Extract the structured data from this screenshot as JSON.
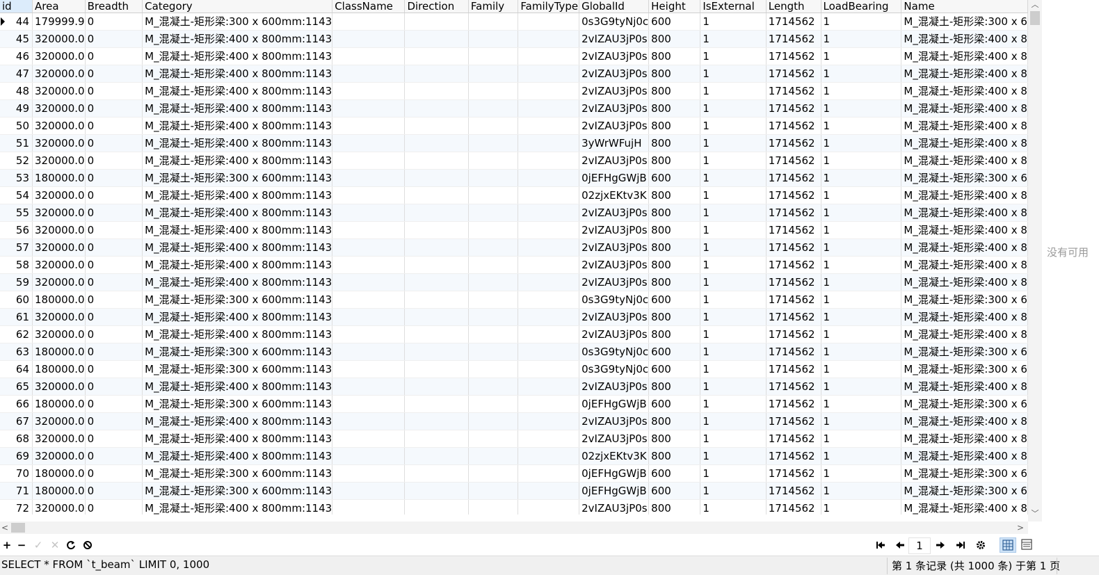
{
  "columns": [
    "id",
    "Area",
    "Breadth",
    "Category",
    "ClassName",
    "Direction",
    "Family",
    "FamilyType",
    "GlobalId",
    "Height",
    "IsExternal",
    "Length",
    "LoadBearing",
    "Name"
  ],
  "rows": [
    [
      "44",
      "179999.9",
      "0",
      "M_混凝土-矩形梁:300 x 600mm:1143",
      "",
      "",
      "",
      "",
      "0s3G9tyNj0c",
      "600",
      "1",
      "1714562",
      "1",
      "M_混凝土-矩形梁:300 x 6"
    ],
    [
      "45",
      "320000.0",
      "0",
      "M_混凝土-矩形梁:400 x 800mm:1143",
      "",
      "",
      "",
      "",
      "2vIZAU3jP0s",
      "800",
      "1",
      "1714562",
      "1",
      "M_混凝土-矩形梁:400 x 8"
    ],
    [
      "46",
      "320000.0",
      "0",
      "M_混凝土-矩形梁:400 x 800mm:1143",
      "",
      "",
      "",
      "",
      "2vIZAU3jP0s",
      "800",
      "1",
      "1714562",
      "1",
      "M_混凝土-矩形梁:400 x 8"
    ],
    [
      "47",
      "320000.0",
      "0",
      "M_混凝土-矩形梁:400 x 800mm:1143",
      "",
      "",
      "",
      "",
      "2vIZAU3jP0s",
      "800",
      "1",
      "1714562",
      "1",
      "M_混凝土-矩形梁:400 x 8"
    ],
    [
      "48",
      "320000.0",
      "0",
      "M_混凝土-矩形梁:400 x 800mm:1143",
      "",
      "",
      "",
      "",
      "2vIZAU3jP0s",
      "800",
      "1",
      "1714562",
      "1",
      "M_混凝土-矩形梁:400 x 8"
    ],
    [
      "49",
      "320000.0",
      "0",
      "M_混凝土-矩形梁:400 x 800mm:1143",
      "",
      "",
      "",
      "",
      "2vIZAU3jP0s",
      "800",
      "1",
      "1714562",
      "1",
      "M_混凝土-矩形梁:400 x 8"
    ],
    [
      "50",
      "320000.0",
      "0",
      "M_混凝土-矩形梁:400 x 800mm:1143",
      "",
      "",
      "",
      "",
      "2vIZAU3jP0s",
      "800",
      "1",
      "1714562",
      "1",
      "M_混凝土-矩形梁:400 x 8"
    ],
    [
      "51",
      "320000.0",
      "0",
      "M_混凝土-矩形梁:400 x 800mm:1143",
      "",
      "",
      "",
      "",
      "3yWrWFujH",
      "800",
      "1",
      "1714562",
      "1",
      "M_混凝土-矩形梁:400 x 8"
    ],
    [
      "52",
      "320000.0",
      "0",
      "M_混凝土-矩形梁:400 x 800mm:1143",
      "",
      "",
      "",
      "",
      "2vIZAU3jP0s",
      "800",
      "1",
      "1714562",
      "1",
      "M_混凝土-矩形梁:400 x 8"
    ],
    [
      "53",
      "180000.0",
      "0",
      "M_混凝土-矩形梁:300 x 600mm:1143",
      "",
      "",
      "",
      "",
      "0jEFHgGWjB",
      "600",
      "1",
      "1714562",
      "1",
      "M_混凝土-矩形梁:300 x 6"
    ],
    [
      "54",
      "320000.0",
      "0",
      "M_混凝土-矩形梁:400 x 800mm:1143",
      "",
      "",
      "",
      "",
      "02zjxEKtv3K",
      "800",
      "1",
      "1714562",
      "1",
      "M_混凝土-矩形梁:400 x 8"
    ],
    [
      "55",
      "320000.0",
      "0",
      "M_混凝土-矩形梁:400 x 800mm:1143",
      "",
      "",
      "",
      "",
      "2vIZAU3jP0s",
      "800",
      "1",
      "1714562",
      "1",
      "M_混凝土-矩形梁:400 x 8"
    ],
    [
      "56",
      "320000.0",
      "0",
      "M_混凝土-矩形梁:400 x 800mm:1143",
      "",
      "",
      "",
      "",
      "2vIZAU3jP0s",
      "800",
      "1",
      "1714562",
      "1",
      "M_混凝土-矩形梁:400 x 8"
    ],
    [
      "57",
      "320000.0",
      "0",
      "M_混凝土-矩形梁:400 x 800mm:1143",
      "",
      "",
      "",
      "",
      "2vIZAU3jP0s",
      "800",
      "1",
      "1714562",
      "1",
      "M_混凝土-矩形梁:400 x 8"
    ],
    [
      "58",
      "320000.0",
      "0",
      "M_混凝土-矩形梁:400 x 800mm:1143",
      "",
      "",
      "",
      "",
      "2vIZAU3jP0s",
      "800",
      "1",
      "1714562",
      "1",
      "M_混凝土-矩形梁:400 x 8"
    ],
    [
      "59",
      "320000.0",
      "0",
      "M_混凝土-矩形梁:400 x 800mm:1143",
      "",
      "",
      "",
      "",
      "2vIZAU3jP0s",
      "800",
      "1",
      "1714562",
      "1",
      "M_混凝土-矩形梁:400 x 8"
    ],
    [
      "60",
      "180000.0",
      "0",
      "M_混凝土-矩形梁:300 x 600mm:1143",
      "",
      "",
      "",
      "",
      "0s3G9tyNj0c",
      "600",
      "1",
      "1714562",
      "1",
      "M_混凝土-矩形梁:300 x 6"
    ],
    [
      "61",
      "320000.0",
      "0",
      "M_混凝土-矩形梁:400 x 800mm:1143",
      "",
      "",
      "",
      "",
      "2vIZAU3jP0s",
      "800",
      "1",
      "1714562",
      "1",
      "M_混凝土-矩形梁:400 x 8"
    ],
    [
      "62",
      "320000.0",
      "0",
      "M_混凝土-矩形梁:400 x 800mm:1143",
      "",
      "",
      "",
      "",
      "2vIZAU3jP0s",
      "800",
      "1",
      "1714562",
      "1",
      "M_混凝土-矩形梁:400 x 8"
    ],
    [
      "63",
      "180000.0",
      "0",
      "M_混凝土-矩形梁:300 x 600mm:1143",
      "",
      "",
      "",
      "",
      "0s3G9tyNj0c",
      "600",
      "1",
      "1714562",
      "1",
      "M_混凝土-矩形梁:300 x 6"
    ],
    [
      "64",
      "180000.0",
      "0",
      "M_混凝土-矩形梁:300 x 600mm:1143",
      "",
      "",
      "",
      "",
      "0s3G9tyNj0c",
      "600",
      "1",
      "1714562",
      "1",
      "M_混凝土-矩形梁:300 x 6"
    ],
    [
      "65",
      "320000.0",
      "0",
      "M_混凝土-矩形梁:400 x 800mm:1143",
      "",
      "",
      "",
      "",
      "2vIZAU3jP0s",
      "800",
      "1",
      "1714562",
      "1",
      "M_混凝土-矩形梁:400 x 8"
    ],
    [
      "66",
      "180000.0",
      "0",
      "M_混凝土-矩形梁:300 x 600mm:1143",
      "",
      "",
      "",
      "",
      "0jEFHgGWjB",
      "600",
      "1",
      "1714562",
      "1",
      "M_混凝土-矩形梁:300 x 6"
    ],
    [
      "67",
      "320000.0",
      "0",
      "M_混凝土-矩形梁:400 x 800mm:1143",
      "",
      "",
      "",
      "",
      "2vIZAU3jP0s",
      "800",
      "1",
      "1714562",
      "1",
      "M_混凝土-矩形梁:400 x 8"
    ],
    [
      "68",
      "320000.0",
      "0",
      "M_混凝土-矩形梁:400 x 800mm:1143",
      "",
      "",
      "",
      "",
      "2vIZAU3jP0s",
      "800",
      "1",
      "1714562",
      "1",
      "M_混凝土-矩形梁:400 x 8"
    ],
    [
      "69",
      "320000.0",
      "0",
      "M_混凝土-矩形梁:400 x 800mm:1143",
      "",
      "",
      "",
      "",
      "02zjxEKtv3K",
      "800",
      "1",
      "1714562",
      "1",
      "M_混凝土-矩形梁:400 x 8"
    ],
    [
      "70",
      "180000.0",
      "0",
      "M_混凝土-矩形梁:300 x 600mm:1143",
      "",
      "",
      "",
      "",
      "0jEFHgGWjB",
      "600",
      "1",
      "1714562",
      "1",
      "M_混凝土-矩形梁:300 x 6"
    ],
    [
      "71",
      "180000.0",
      "0",
      "M_混凝土-矩形梁:300 x 600mm:1143",
      "",
      "",
      "",
      "",
      "0jEFHgGWjB",
      "600",
      "1",
      "1714562",
      "1",
      "M_混凝土-矩形梁:300 x 6"
    ],
    [
      "72",
      "320000.0",
      "0",
      "M_混凝土-矩形梁:400 x 800mm:1143",
      "",
      "",
      "",
      "",
      "2vIZAU3jP0s",
      "800",
      "1",
      "1714562",
      "1",
      "M_混凝土-矩形梁:400 x 8"
    ]
  ],
  "side_panel": {
    "empty_text": "没有可用"
  },
  "toolbar": {
    "add_icon": "plus-icon",
    "delete_icon": "minus-icon",
    "apply_icon": "check-icon",
    "discard_icon": "x-icon",
    "refresh_icon": "refresh-icon",
    "stop_icon": "stop-icon",
    "page_value": "1",
    "grid_view_icon": "grid-view-icon",
    "form_view_icon": "form-view-icon"
  },
  "status": {
    "sql": "SELECT * FROM `t_beam` LIMIT 0, 1000",
    "records": "第 1 条记录 (共 1000 条) 于第 1 页"
  },
  "colors": {
    "header_bg": "#f7f7f7",
    "selected_header": "#dcecfb",
    "alt_row": "#f5f9fd",
    "statusbar_bg": "#f0f0f0"
  }
}
